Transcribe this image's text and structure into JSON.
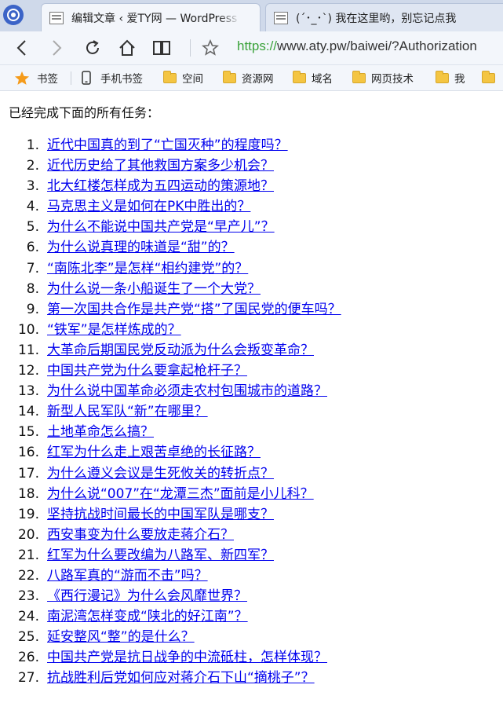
{
  "browser": {
    "tabs": [
      {
        "title": "编辑文章 ‹ 爱TY网 — WordPress",
        "active": true
      },
      {
        "title": "(´･_･`) 我在这里哟，别忘记点我",
        "active": false
      }
    ],
    "url_protocol": "https://",
    "url_rest": "www.aty.pw/baiwei/?Authorization",
    "bookmarks": [
      {
        "label": "书签",
        "icon": "star-icon"
      },
      {
        "label": "手机书签",
        "icon": "phone-icon"
      },
      {
        "label": "空间",
        "icon": "folder-icon"
      },
      {
        "label": "资源网",
        "icon": "folder-icon"
      },
      {
        "label": "域名",
        "icon": "folder-icon"
      },
      {
        "label": "网页技术",
        "icon": "folder-icon"
      },
      {
        "label": "我",
        "icon": "folder-icon"
      }
    ]
  },
  "page": {
    "heading": "已经完成下面的所有任务：",
    "tasks": [
      {
        "num": "1.",
        "title": "近代中国真的到了“亡国灭种”的程度吗？"
      },
      {
        "num": "2.",
        "title": "近代历史给了其他救国方案多少机会？"
      },
      {
        "num": "3.",
        "title": "北大红楼怎样成为五四运动的策源地？"
      },
      {
        "num": "4.",
        "title": "马克思主义是如何在PK中胜出的？"
      },
      {
        "num": "5.",
        "title": "为什么不能说中国共产党是“早产儿”？"
      },
      {
        "num": "6.",
        "title": "为什么说真理的味道是“甜”的？"
      },
      {
        "num": "7.",
        "title": "“南陈北李”是怎样“相约建党”的？"
      },
      {
        "num": "8.",
        "title": "为什么说一条小船诞生了一个大党？"
      },
      {
        "num": "9.",
        "title": "第一次国共合作是共产党“搭”了国民党的便车吗？"
      },
      {
        "num": "10.",
        "title": "“铁军”是怎样炼成的？"
      },
      {
        "num": "11.",
        "title": "大革命后期国民党反动派为什么会叛变革命？"
      },
      {
        "num": "12.",
        "title": "中国共产党为什么要拿起枪杆子？"
      },
      {
        "num": "13.",
        "title": "为什么说中国革命必须走农村包围城市的道路？"
      },
      {
        "num": "14.",
        "title": "新型人民军队“新”在哪里？"
      },
      {
        "num": "15.",
        "title": "土地革命怎么搞？"
      },
      {
        "num": "16.",
        "title": "红军为什么走上艰苦卓绝的长征路？"
      },
      {
        "num": "17.",
        "title": "为什么遵义会议是生死攸关的转折点？"
      },
      {
        "num": "18.",
        "title": "为什么说“007”在“龙潭三杰”面前是小儿科？"
      },
      {
        "num": "19.",
        "title": "坚持抗战时间最长的中国军队是哪支？"
      },
      {
        "num": "20.",
        "title": "西安事变为什么要放走蒋介石？"
      },
      {
        "num": "21.",
        "title": "红军为什么要改编为八路军、新四军？"
      },
      {
        "num": "22.",
        "title": "八路军真的“游而不击”吗？"
      },
      {
        "num": "23.",
        "title": "《西行漫记》为什么会风靡世界？"
      },
      {
        "num": "24.",
        "title": "南泥湾怎样变成“陕北的好江南”？"
      },
      {
        "num": "25.",
        "title": "延安整风“整”的是什么？"
      },
      {
        "num": "26.",
        "title": "中国共产党是抗日战争的中流砥柱，怎样体现？"
      },
      {
        "num": "27.",
        "title": "抗战胜利后党如何应对蒋介石下山“摘桃子”？"
      }
    ]
  }
}
